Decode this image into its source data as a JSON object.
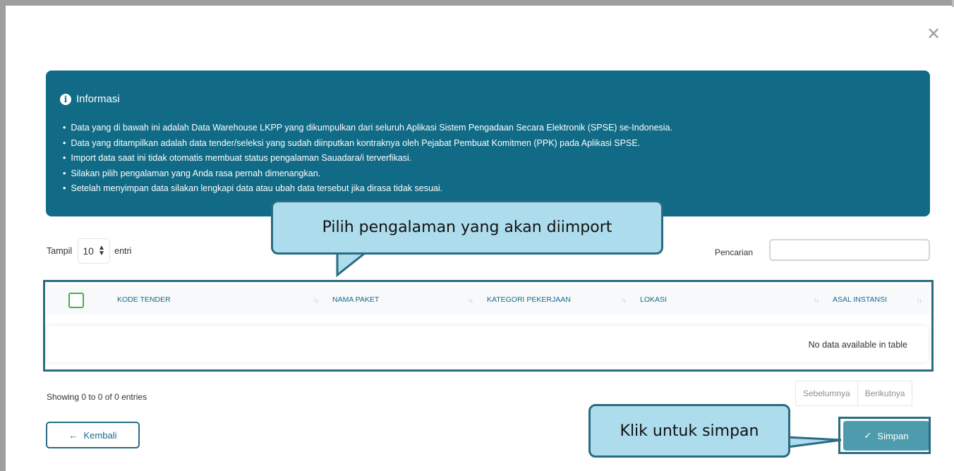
{
  "modal": {
    "close_label": "✕"
  },
  "info": {
    "title": "Informasi",
    "icon": "info-circle-icon",
    "items": [
      "Data yang di bawah ini adalah Data Warehouse LKPP yang dikumpulkan dari seluruh Aplikasi Sistem Pengadaan Secara Elektronik (SPSE) se-Indonesia.",
      "Data yang ditampilkan adalah data tender/seleksi yang sudah diinputkan kontraknya oleh Pejabat Pembuat Komitmen (PPK) pada Aplikasi SPSE.",
      "Import data saat ini tidak otomatis membuat status pengalaman Sauadara/i terverfikasi.",
      "Silakan pilih pengalaman yang Anda rasa pernah dimenangkan.",
      "Setelah menyimpan data silakan lengkapi data atau ubah data tersebut jika dirasa tidak sesuai."
    ],
    "background_color": "#116b86"
  },
  "table_controls": {
    "show_label": "Tampil",
    "page_length": "10",
    "entries_label": "entri",
    "search_label": "Pencarian",
    "search_value": ""
  },
  "table": {
    "columns": [
      "KODE TENDER",
      "NAMA PAKET",
      "KATEGORI PEKERJAAN",
      "LOKASI",
      "ASAL INSTANSI"
    ],
    "empty_message": "No data available in table"
  },
  "pagination": {
    "showing_text": "Showing 0 to 0 of 0 entries",
    "prev_label": "Sebelumnya",
    "next_label": "Berikutnya"
  },
  "actions": {
    "back_label": "Kembali",
    "save_label": "Simpan"
  },
  "callouts": {
    "select_hint": "Pilih pengalaman yang akan diimport",
    "save_hint": "Klik untuk simpan"
  },
  "colors": {
    "accent": "#176b94",
    "callout_fill": "#addcec",
    "callout_border": "#2a6c83",
    "save_button": "#4d9cae"
  }
}
